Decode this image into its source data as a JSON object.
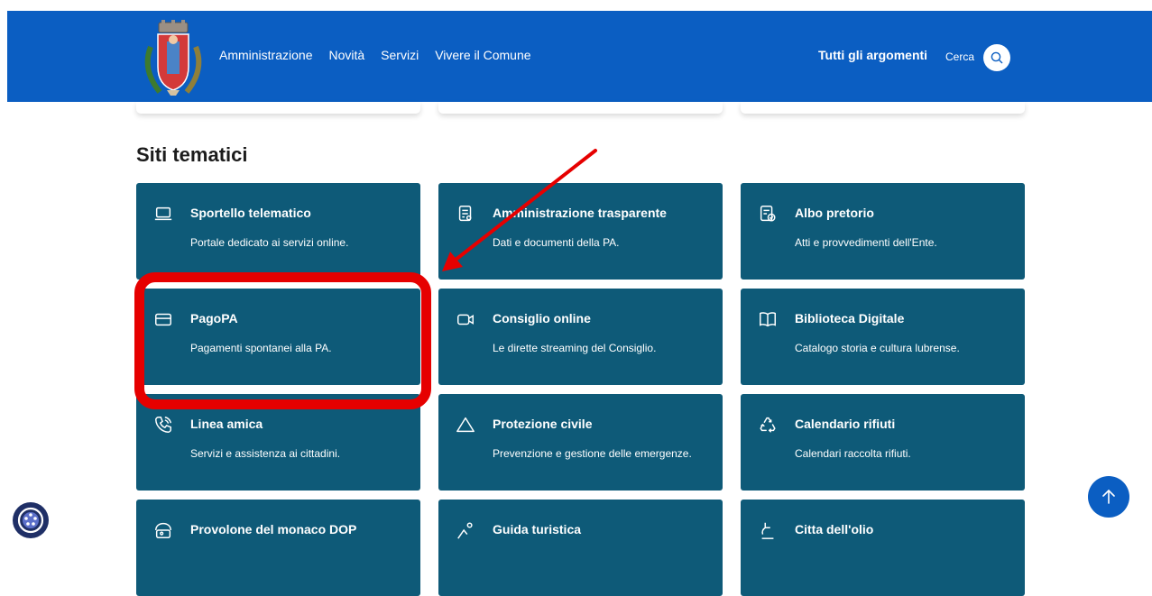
{
  "header": {
    "nav_items": [
      "Amministrazione",
      "Novità",
      "Servizi",
      "Vivere il Comune"
    ],
    "topics_label": "Tutti gli argomenti",
    "search_label": "Cerca"
  },
  "colors": {
    "header_bg": "#0b5ec2",
    "tile_bg": "#0e5a78",
    "annotation": "#e60000"
  },
  "section": {
    "title": "Siti tematici"
  },
  "tiles": [
    {
      "icon": "laptop-icon",
      "title": "Sportello telematico",
      "desc": "Portale dedicato ai servizi online."
    },
    {
      "icon": "document-icon",
      "title": "Amministrazione trasparente",
      "desc": "Dati e documenti della PA."
    },
    {
      "icon": "checked-document-icon",
      "title": "Albo pretorio",
      "desc": "Atti e provvedimenti dell'Ente."
    },
    {
      "icon": "card-icon",
      "title": "PagoPA",
      "desc": "Pagamenti spontanei alla PA."
    },
    {
      "icon": "video-icon",
      "title": "Consiglio online",
      "desc": "Le dirette streaming del Consiglio."
    },
    {
      "icon": "book-icon",
      "title": "Biblioteca Digitale",
      "desc": "Catalogo storia e cultura lubrense."
    },
    {
      "icon": "phone-icon",
      "title": "Linea amica",
      "desc": "Servizi e assistenza ai cittadini."
    },
    {
      "icon": "warning-icon",
      "title": "Protezione civile",
      "desc": "Prevenzione e gestione delle emergenze."
    },
    {
      "icon": "recycle-icon",
      "title": "Calendario rifiuti",
      "desc": "Calendari raccolta rifiuti."
    },
    {
      "icon": "cheese-icon",
      "title": "Provolone del monaco DOP",
      "desc": ""
    },
    {
      "icon": "map-pin-icon",
      "title": "Guida turistica",
      "desc": ""
    },
    {
      "icon": "olive-icon",
      "title": "Citta dell'olio",
      "desc": ""
    }
  ]
}
